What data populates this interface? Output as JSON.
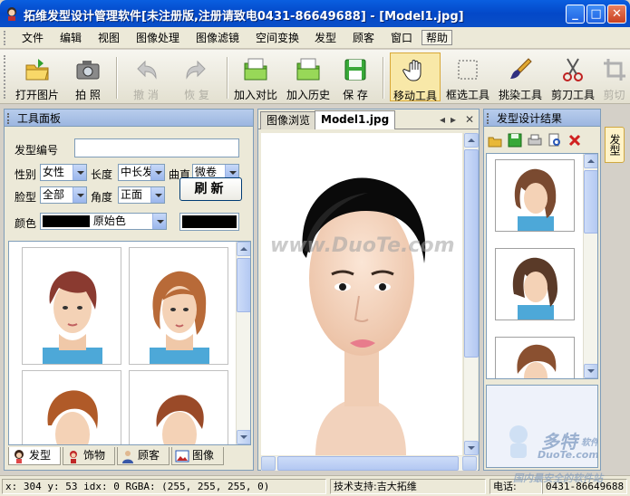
{
  "window": {
    "title": "拓维发型设计管理软件[未注册版,注册请致电0431-86649688] - [Model1.jpg]",
    "min_label": "_",
    "max_label": "□",
    "close_label": "✕"
  },
  "menu": {
    "items": [
      "文件",
      "编辑",
      "视图",
      "图像处理",
      "图像滤镜",
      "空间变换",
      "发型",
      "顾客",
      "窗口",
      "帮助"
    ]
  },
  "toolbar": {
    "open": "打开图片",
    "photo": "拍 照",
    "undo": "撤 消",
    "redo": "恢 复",
    "add_compare": "加入对比",
    "add_history": "加入历史",
    "save": "保 存",
    "move": "移动工具",
    "select": "框选工具",
    "pick": "挑染工具",
    "cut": "剪刀工具",
    "crop": "剪切"
  },
  "tool_panel": {
    "title": "工具面板",
    "style_no_label": "发型编号",
    "style_no_value": "",
    "gender_label": "性别",
    "gender_value": "女性",
    "length_label": "长度",
    "length_value": "中长发",
    "curl_label": "曲直",
    "curl_value": "微卷",
    "face_label": "脸型",
    "face_value": "全部",
    "angle_label": "角度",
    "angle_value": "正面",
    "refresh": "刷新",
    "color_label": "颜色",
    "color_value": "原始色",
    "color_swatch": "#000000"
  },
  "left_tabs": [
    "发型",
    "饰物",
    "顾客",
    "图像"
  ],
  "image_panel": {
    "tabs": [
      "图像浏览",
      "Model1.jpg"
    ],
    "tab_prev": "◂",
    "tab_next": "▸",
    "tab_close": "✕",
    "watermark": "www.DuoTe.com"
  },
  "result_panel": {
    "title": "发型设计结果",
    "icons": [
      "open-folder-icon",
      "save-disk-icon",
      "print-icon",
      "preview-icon",
      "delete-icon"
    ]
  },
  "side_tab": {
    "label": "发型"
  },
  "statusbar": {
    "coords": "x: 304 y: 53  idx: 0  RGBA: (255, 255, 255, 0)",
    "support": "技术支持:吉大拓维",
    "phone_label": "电话:",
    "phone_value": "0431-86649688"
  },
  "brand_watermark": {
    "name": "多特",
    "sub": "软件站",
    "url": "DuoTe.com",
    "slogan": "国内最安全的软件站"
  },
  "colors": {
    "accent": "#0a5fe0",
    "panel_header": "#9cb6e0",
    "pressed": "#f8e8a8"
  }
}
